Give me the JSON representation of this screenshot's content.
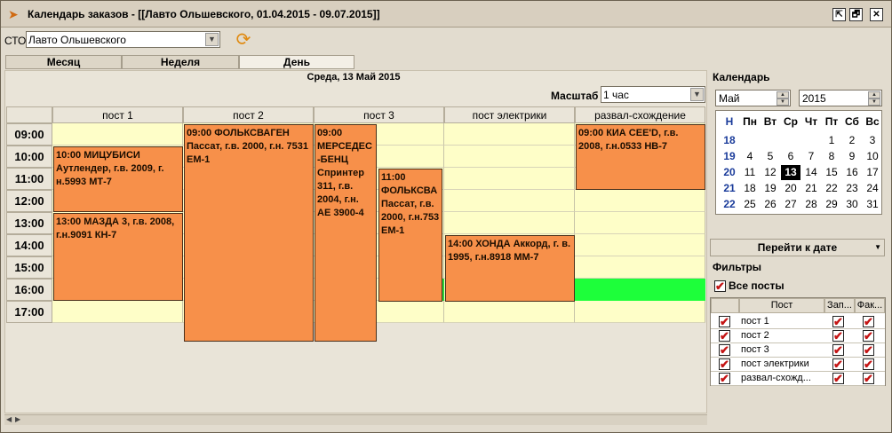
{
  "window": {
    "title": "Календарь заказов - [[Лавто Ольшевского, 01.04.2015 - 09.07.2015]]",
    "buttons": [
      "⇱",
      "🗗",
      "✕"
    ]
  },
  "toolbar": {
    "sto_label": "СТО",
    "sto_value": "Лавто Ольшевского"
  },
  "view_tabs": [
    {
      "label": "Месяц",
      "active": false
    },
    {
      "label": "Неделя",
      "active": false
    },
    {
      "label": "День",
      "active": true
    }
  ],
  "day_header": "Среда, 13 Май 2015",
  "scale": {
    "label": "Масштаб",
    "value": "1 час"
  },
  "columns": [
    "пост 1",
    "пост 2",
    "пост 3",
    "пост  электрики",
    "развал-схождение"
  ],
  "times": [
    "09:00",
    "10:00",
    "11:00",
    "12:00",
    "13:00",
    "14:00",
    "15:00",
    "16:00",
    "17:00"
  ],
  "events": [
    {
      "col": 0,
      "text": "10:00 МИЦУБИСИ Аутлендер, г.в. 2009, г. н.5993 МТ-7"
    },
    {
      "col": 0,
      "text": "13:00 МАЗДА 3, г.в. 2008, г.н.9091 КН-7"
    },
    {
      "col": 1,
      "text": "09:00 ФОЛЬКСВАГЕН Пассат, г.в. 2000, г.н. 7531 ЕМ-1"
    },
    {
      "col": 2,
      "text": "09:00 МЕРСЕДЕС -БЕНЦ Спринтер 311, г.в. 2004, г.н. АЕ 3900-4"
    },
    {
      "col": 2,
      "text": "11:00 ФОЛЬКСВА Пассат, г.в. 2000, г.н.753 ЕМ-1"
    },
    {
      "col": 3,
      "text": "14:00 ХОНДА Аккорд, г. в. 1995, г.н.8918 ММ-7"
    },
    {
      "col": 4,
      "text": "09:00 КИА CEE'D, г.в. 2008, г.н.0533 НВ-7"
    }
  ],
  "calendar": {
    "label": "Календарь",
    "month": "Май",
    "year": "2015",
    "header": [
      "Н",
      "Пн",
      "Вт",
      "Ср",
      "Чт",
      "Пт",
      "Сб",
      "Вс"
    ],
    "weeks": [
      {
        "n": "18",
        "days": [
          "",
          "",
          "",
          "1",
          "2",
          "3"
        ],
        "offset": 4
      },
      {
        "n": "19",
        "days": [
          "4",
          "5",
          "6",
          "7",
          "8",
          "9",
          "10"
        ],
        "offset": 0
      },
      {
        "n": "20",
        "days": [
          "11",
          "12",
          "13",
          "14",
          "15",
          "16",
          "17"
        ],
        "offset": 0
      },
      {
        "n": "21",
        "days": [
          "18",
          "19",
          "20",
          "21",
          "22",
          "23",
          "24"
        ],
        "offset": 0
      },
      {
        "n": "22",
        "days": [
          "25",
          "26",
          "27",
          "28",
          "29",
          "30",
          "31"
        ],
        "offset": 0
      }
    ],
    "today": "13",
    "goto_label": "Перейти к дате"
  },
  "filters": {
    "label": "Фильтры",
    "all_posts_label": "Все посты",
    "headers": [
      "Пост",
      "Зап...",
      "Фак..."
    ],
    "rows": [
      "пост 1",
      "пост 2",
      "пост 3",
      "пост  электрики",
      "развал-схожд..."
    ]
  }
}
